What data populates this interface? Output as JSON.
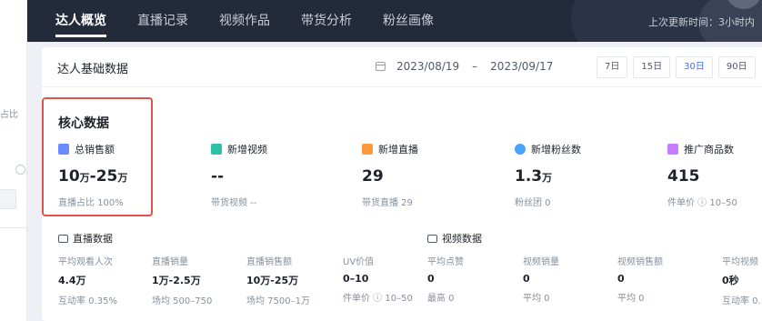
{
  "left_panel": {
    "partial_text": "占比"
  },
  "nav": {
    "tabs": [
      {
        "label": "达人概览",
        "active": true
      },
      {
        "label": "直播记录",
        "active": false
      },
      {
        "label": "视频作品",
        "active": false
      },
      {
        "label": "带货分析",
        "active": false
      },
      {
        "label": "粉丝画像",
        "active": false
      }
    ],
    "update_time": "上次更新时间：3小时内"
  },
  "base": {
    "title": "达人基础数据",
    "date_start": "2023/08/19",
    "date_sep": "–",
    "date_end": "2023/09/17",
    "ranges": [
      "7日",
      "15日",
      "30日",
      "90日"
    ],
    "active_range": "30日"
  },
  "core": {
    "title": "核心数据",
    "metrics": [
      {
        "label": "总销售额",
        "value": "10",
        "unit": "万",
        "value2": "-25",
        "unit2": "万",
        "sub": "直播占比 100%",
        "icon": "sales-icon",
        "color": "#6b8cff"
      },
      {
        "label": "新增视频",
        "value": "--",
        "sub": "带货视频 --",
        "icon": "video-icon",
        "color": "#2bc2a7"
      },
      {
        "label": "新增直播",
        "value": "29",
        "sub": "带货直播 29",
        "icon": "live-icon",
        "color": "#ff9a3c"
      },
      {
        "label": "新增粉丝数",
        "value": "1.3",
        "unit": "万",
        "sub": "粉丝团 0",
        "icon": "fans-icon",
        "color": "#4aa3ff"
      },
      {
        "label": "推广商品数",
        "value": "415",
        "sub": "件单价 ⓘ 10–50",
        "icon": "product-icon",
        "color": "#c77dff"
      }
    ]
  },
  "live": {
    "title": "直播数据",
    "stats": [
      {
        "label": "平均观看人次",
        "value": "4.4万",
        "sub": "互动率 0.35%"
      },
      {
        "label": "直播销量",
        "value": "1万-2.5万",
        "sub": "场均 500–750"
      },
      {
        "label": "直播销售额",
        "value": "10万-25万",
        "sub": "场均 7500–1万"
      },
      {
        "label": "UV价值",
        "value": "0–10",
        "sub": "件单价 ⓘ 10–50"
      },
      {
        "label": "平均点赞",
        "value": "0",
        "sub": "最高 0"
      }
    ]
  },
  "video": {
    "title": "视频数据",
    "stats": [
      {
        "label": "视频销量",
        "value": "0",
        "sub": "平均 0"
      },
      {
        "label": "视频销售额",
        "value": "0",
        "sub": "平均 0"
      },
      {
        "label": "平均视频",
        "value": "0秒",
        "sub": "互动率 0."
      }
    ]
  }
}
